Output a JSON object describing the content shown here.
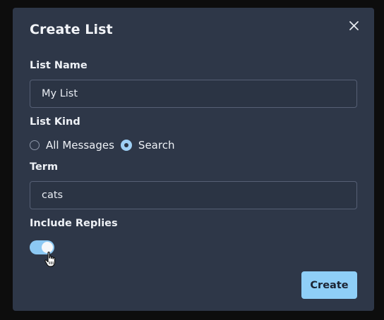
{
  "modal": {
    "title": "Create List",
    "close_icon": "close-icon"
  },
  "list_name": {
    "label": "List Name",
    "value": "My List"
  },
  "list_kind": {
    "label": "List Kind",
    "options": [
      {
        "label": "All Messages",
        "checked": false
      },
      {
        "label": "Search",
        "checked": true
      }
    ]
  },
  "term": {
    "label": "Term",
    "value": "cats"
  },
  "include_replies": {
    "label": "Include Replies",
    "enabled": true
  },
  "actions": {
    "create_label": "Create"
  },
  "colors": {
    "accent": "#8fcff7",
    "panel": "#2e3748",
    "backdrop": "#0d0d0d"
  }
}
